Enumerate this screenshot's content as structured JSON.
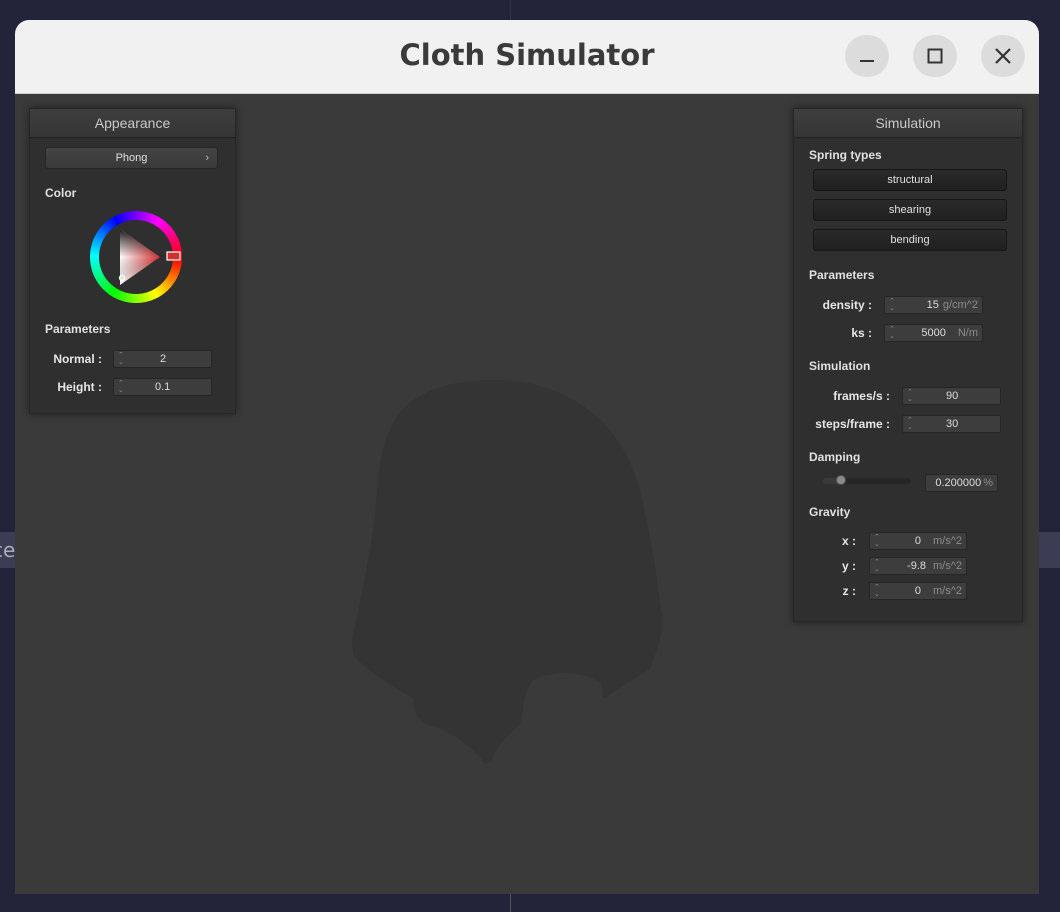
{
  "window": {
    "title": "Cloth Simulator"
  },
  "background": {
    "partial_text": "ce"
  },
  "appearance": {
    "header": "Appearance",
    "shader": "Phong",
    "color_label": "Color",
    "selected_color": "#d32f2f",
    "parameters_label": "Parameters",
    "normal": {
      "label": "Normal :",
      "value": "2"
    },
    "height": {
      "label": "Height :",
      "value": "0.1"
    }
  },
  "simulation": {
    "header": "Simulation",
    "spring_types_label": "Spring types",
    "springs": [
      "structural",
      "shearing",
      "bending"
    ],
    "parameters_label": "Parameters",
    "density": {
      "label": "density :",
      "value": "15",
      "unit": "g/cm^2"
    },
    "ks": {
      "label": "ks :",
      "value": "5000",
      "unit": "N/m"
    },
    "simulation_label": "Simulation",
    "fps": {
      "label": "frames/s :",
      "value": "90"
    },
    "steps": {
      "label": "steps/frame :",
      "value": "30"
    },
    "damping_label": "Damping",
    "damping": {
      "value": "0.200000",
      "unit": "%",
      "fraction": 0.2
    },
    "gravity_label": "Gravity",
    "gx": {
      "label": "x :",
      "value": "0",
      "unit": "m/s^2"
    },
    "gy": {
      "label": "y :",
      "value": "-9.8",
      "unit": "m/s^2"
    },
    "gz": {
      "label": "z :",
      "value": "0",
      "unit": "m/s^2"
    }
  }
}
